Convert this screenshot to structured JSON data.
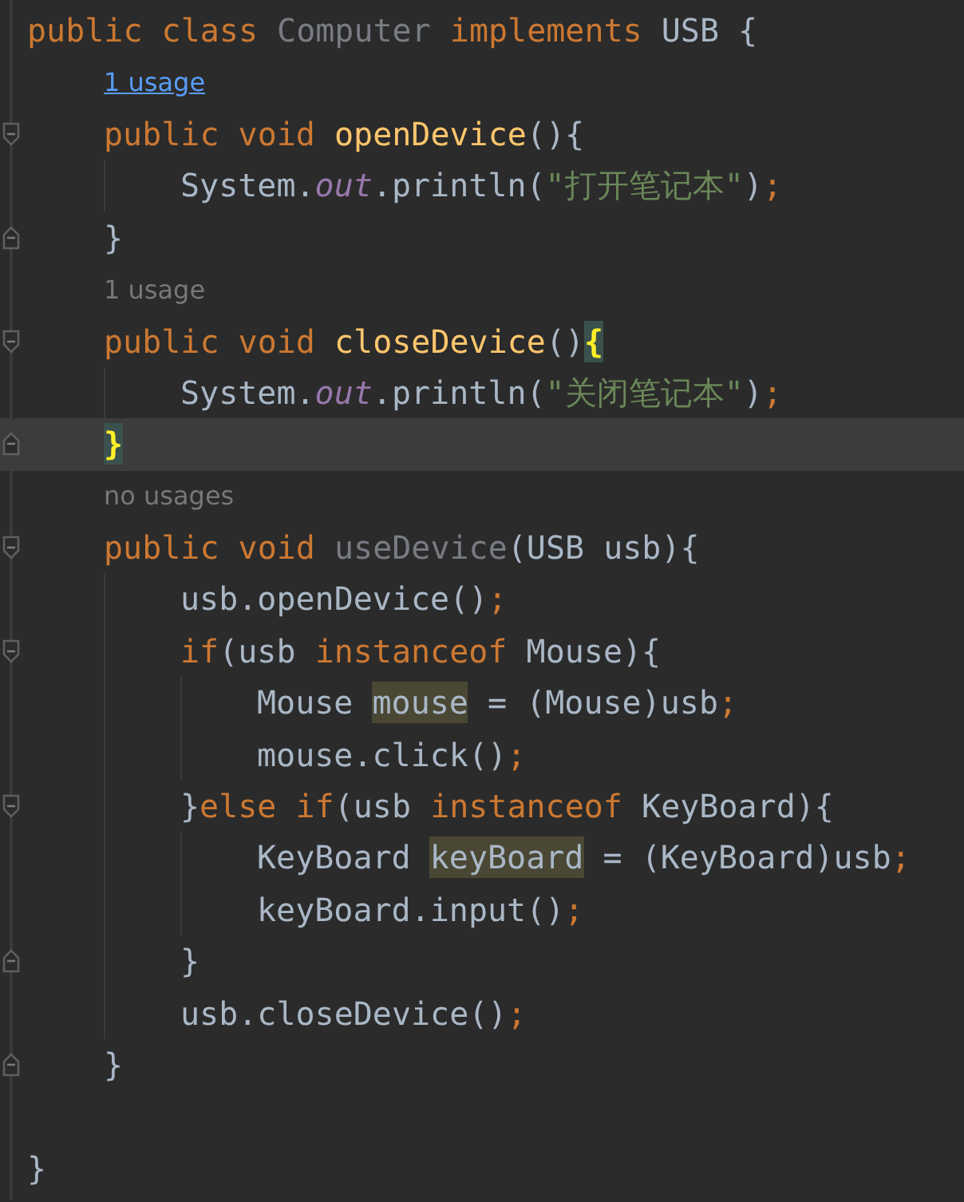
{
  "editor": {
    "lines": [
      {
        "kind": "code",
        "block_start": false,
        "block_end": false,
        "current": false,
        "tokens": [
          {
            "text": "public class ",
            "kind": "keyword"
          },
          {
            "text": "Computer",
            "kind": "unused"
          },
          {
            "text": " implements ",
            "kind": "keyword"
          },
          {
            "text": "USB {",
            "kind": "plain"
          }
        ],
        "children": [
          {
            "kind": "hint-link",
            "text": "1 usage"
          },
          {
            "kind": "code",
            "block_start": true,
            "block_end": false,
            "current": false,
            "tokens": [
              {
                "text": "public void ",
                "kind": "keyword"
              },
              {
                "text": "openDevice",
                "kind": "declaration"
              },
              {
                "text": "(){",
                "kind": "plain"
              }
            ],
            "children": [
              {
                "kind": "code",
                "block_start": false,
                "block_end": false,
                "current": false,
                "tokens": [
                  {
                    "text": "System.",
                    "kind": "plain"
                  },
                  {
                    "text": "out",
                    "kind": "field"
                  },
                  {
                    "text": ".println(",
                    "kind": "plain"
                  },
                  {
                    "text": "\"打开笔记本\"",
                    "kind": "string"
                  },
                  {
                    "text": ")",
                    "kind": "plain"
                  },
                  {
                    "text": ";",
                    "kind": "semicolon"
                  }
                ]
              }
            ]
          },
          {
            "kind": "code",
            "block_start": false,
            "block_end": true,
            "current": false,
            "tokens": [
              {
                "text": "}",
                "kind": "plain"
              }
            ]
          },
          {
            "kind": "hint",
            "text": "1 usage"
          },
          {
            "kind": "code",
            "block_start": true,
            "block_end": false,
            "current": false,
            "tokens": [
              {
                "text": "public void ",
                "kind": "keyword"
              },
              {
                "text": "closeDevice",
                "kind": "declaration"
              },
              {
                "text": "()",
                "kind": "plain"
              },
              {
                "text": "{",
                "kind": "match"
              }
            ],
            "children": [
              {
                "kind": "code",
                "block_start": false,
                "block_end": false,
                "current": false,
                "tokens": [
                  {
                    "text": "System.",
                    "kind": "plain"
                  },
                  {
                    "text": "out",
                    "kind": "field"
                  },
                  {
                    "text": ".println(",
                    "kind": "plain"
                  },
                  {
                    "text": "\"关闭笔记本\"",
                    "kind": "string"
                  },
                  {
                    "text": ")",
                    "kind": "plain"
                  },
                  {
                    "text": ";",
                    "kind": "semicolon"
                  }
                ]
              }
            ]
          },
          {
            "kind": "code",
            "block_start": false,
            "block_end": true,
            "current": true,
            "tokens": [
              {
                "text": "}",
                "kind": "match"
              }
            ]
          },
          {
            "kind": "hint",
            "text": "no usages"
          },
          {
            "kind": "code",
            "block_start": true,
            "block_end": false,
            "current": false,
            "tokens": [
              {
                "text": "public void ",
                "kind": "keyword"
              },
              {
                "text": "useDevice",
                "kind": "unused"
              },
              {
                "text": "(USB usb){",
                "kind": "plain"
              }
            ],
            "children": [
              {
                "kind": "code",
                "block_start": false,
                "block_end": false,
                "current": false,
                "tokens": [
                  {
                    "text": "usb.openDevice()",
                    "kind": "plain"
                  },
                  {
                    "text": ";",
                    "kind": "semicolon"
                  }
                ]
              },
              {
                "kind": "code",
                "block_start": true,
                "block_end": false,
                "current": false,
                "tokens": [
                  {
                    "text": "if",
                    "kind": "keyword"
                  },
                  {
                    "text": "(usb ",
                    "kind": "plain"
                  },
                  {
                    "text": "instanceof",
                    "kind": "keyword"
                  },
                  {
                    "text": " Mouse){",
                    "kind": "plain"
                  }
                ],
                "children": [
                  {
                    "kind": "code",
                    "block_start": false,
                    "block_end": false,
                    "current": false,
                    "tokens": [
                      {
                        "text": "Mouse ",
                        "kind": "plain"
                      },
                      {
                        "text": "mouse",
                        "kind": "variable"
                      },
                      {
                        "text": " = (Mouse)usb",
                        "kind": "plain"
                      },
                      {
                        "text": ";",
                        "kind": "semicolon"
                      }
                    ]
                  },
                  {
                    "kind": "code",
                    "block_start": false,
                    "block_end": false,
                    "current": false,
                    "tokens": [
                      {
                        "text": "mouse.click()",
                        "kind": "plain"
                      },
                      {
                        "text": ";",
                        "kind": "semicolon"
                      }
                    ]
                  }
                ]
              },
              {
                "kind": "code",
                "block_start": true,
                "block_end": false,
                "current": false,
                "tokens": [
                  {
                    "text": "}",
                    "kind": "plain"
                  },
                  {
                    "text": "else if",
                    "kind": "keyword"
                  },
                  {
                    "text": "(usb ",
                    "kind": "plain"
                  },
                  {
                    "text": "instanceof",
                    "kind": "keyword"
                  },
                  {
                    "text": " KeyBoard){",
                    "kind": "plain"
                  }
                ],
                "children": [
                  {
                    "kind": "code",
                    "block_start": false,
                    "block_end": false,
                    "current": false,
                    "tokens": [
                      {
                        "text": "KeyBoard ",
                        "kind": "plain"
                      },
                      {
                        "text": "keyBoard",
                        "kind": "variable"
                      },
                      {
                        "text": " = (KeyBoard)usb",
                        "kind": "plain"
                      },
                      {
                        "text": ";",
                        "kind": "semicolon"
                      }
                    ]
                  },
                  {
                    "kind": "code",
                    "block_start": false,
                    "block_end": false,
                    "current": false,
                    "tokens": [
                      {
                        "text": "keyBoard.input()",
                        "kind": "plain"
                      },
                      {
                        "text": ";",
                        "kind": "semicolon"
                      }
                    ]
                  }
                ]
              },
              {
                "kind": "code",
                "block_start": false,
                "block_end": true,
                "current": false,
                "tokens": [
                  {
                    "text": "}",
                    "kind": "plain"
                  }
                ]
              },
              {
                "kind": "code",
                "block_start": false,
                "block_end": false,
                "current": false,
                "tokens": [
                  {
                    "text": "usb.closeDevice()",
                    "kind": "plain"
                  },
                  {
                    "text": ";",
                    "kind": "semicolon"
                  }
                ]
              }
            ]
          },
          {
            "kind": "code",
            "block_start": false,
            "block_end": true,
            "current": false,
            "tokens": [
              {
                "text": "}",
                "kind": "plain"
              }
            ]
          },
          {
            "kind": "blank"
          }
        ]
      },
      {
        "kind": "code",
        "block_start": false,
        "block_end": false,
        "current": false,
        "tokens": [
          {
            "text": "}",
            "kind": "plain"
          }
        ]
      }
    ]
  }
}
